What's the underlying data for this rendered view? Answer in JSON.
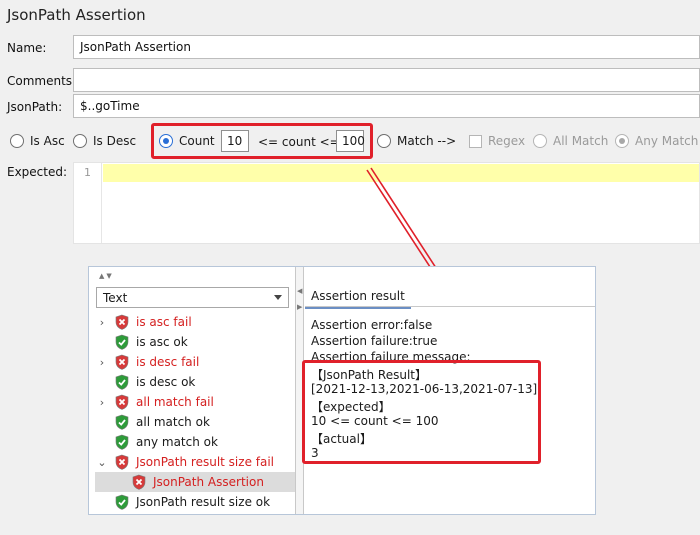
{
  "title": "JsonPath Assertion",
  "fields": {
    "name_label": "Name:",
    "name_value": "JsonPath Assertion",
    "comments_label": "Comments:",
    "comments_value": "",
    "jsonpath_label": "JsonPath:",
    "jsonpath_value": "$..goTime"
  },
  "options": {
    "is_asc": "Is Asc",
    "is_desc": "Is Desc",
    "count": "Count",
    "count_min": "10",
    "count_middle": "<= count <=",
    "count_max": "100",
    "match": "Match -->",
    "regex": "Regex",
    "all_match": "All Match",
    "any_match": "Any Match",
    "selected": "Count"
  },
  "expected": {
    "label": "Expected:",
    "line_number": "1"
  },
  "results": {
    "dropdown_value": "Text",
    "tab_label": "Assertion result",
    "tree": [
      {
        "label": "is asc fail",
        "status": "fail",
        "expandable": true
      },
      {
        "label": "is asc ok",
        "status": "ok",
        "expandable": false
      },
      {
        "label": "is desc fail",
        "status": "fail",
        "expandable": true
      },
      {
        "label": "is desc ok",
        "status": "ok",
        "expandable": false
      },
      {
        "label": "all match fail",
        "status": "fail",
        "expandable": true
      },
      {
        "label": "all match ok",
        "status": "ok",
        "expandable": false
      },
      {
        "label": "any match ok",
        "status": "ok",
        "expandable": false
      },
      {
        "label": "JsonPath result size fail",
        "status": "fail",
        "expandable": true,
        "expanded": true
      },
      {
        "label": "JsonPath Assertion",
        "status": "fail",
        "child": true,
        "selected": true
      },
      {
        "label": "JsonPath result size ok",
        "status": "ok",
        "expandable": false
      }
    ],
    "lines": [
      "Assertion error:false",
      "Assertion failure:true",
      "Assertion failure message:",
      "【JsonPath Result】",
      "[2021-12-13,2021-06-13,2021-07-13]",
      "【expected】",
      "10 <= count <= 100",
      "【actual】",
      "3"
    ]
  },
  "colors": {
    "highlight": "#e0202a",
    "fail_text": "#d42020",
    "radio_selected": "#2a6fd6",
    "editor_line": "#ffffaa"
  }
}
